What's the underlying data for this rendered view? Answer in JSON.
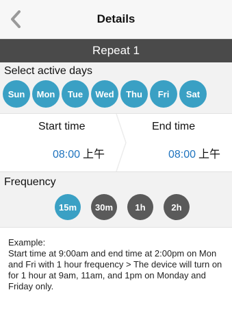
{
  "nav": {
    "title": "Details"
  },
  "banner": {
    "title": "Repeat 1"
  },
  "days": {
    "label": "Select active days",
    "items": [
      "Sun",
      "Mon",
      "Tue",
      "Wed",
      "Thu",
      "Fri",
      "Sat"
    ]
  },
  "times": {
    "start_label": "Start time",
    "start_value": "08:00",
    "start_ampm": "上午",
    "end_label": "End time",
    "end_value": "08:00",
    "end_ampm": "上午"
  },
  "frequency": {
    "label": "Frequency",
    "options": [
      "15m",
      "30m",
      "1h",
      "2h"
    ],
    "selected": "15m"
  },
  "example": {
    "title": "Example:",
    "text": "Start time at 9:00am and end time at 2:00pm on Mon and Fri with 1 hour frequency > The device will turn on for 1 hour at 9am, 11am, and 1pm on Monday and Friday only."
  },
  "colors": {
    "accent": "#3aa0c4",
    "inactive": "#5a5a5a",
    "banner": "#4a4a4a",
    "time_value": "#1e73be"
  }
}
